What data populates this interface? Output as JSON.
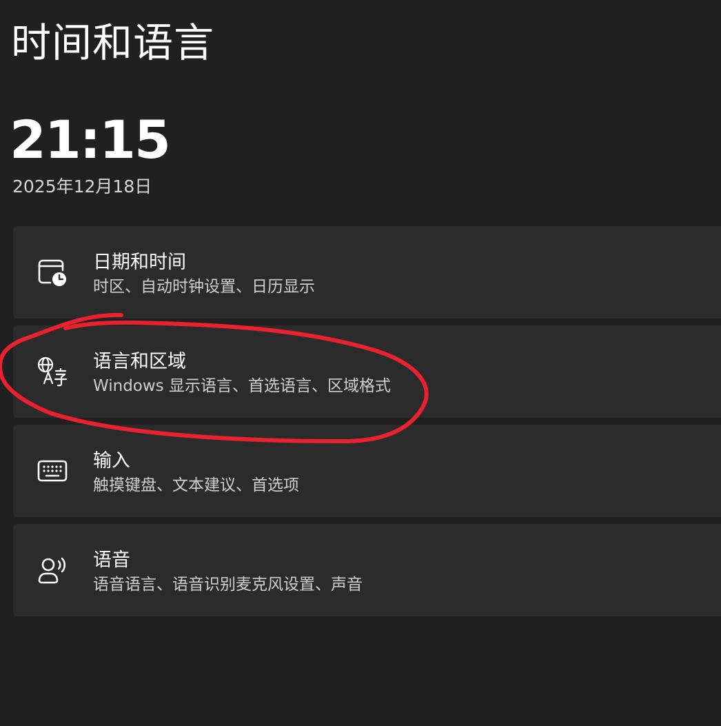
{
  "page": {
    "title": "时间和语言",
    "clock": "21:15",
    "date": "2025年12月18日"
  },
  "cards": [
    {
      "title": "日期和时间",
      "subtitle": "时区、自动时钟设置、日历显示",
      "icon": "calendar-clock-icon"
    },
    {
      "title": "语言和区域",
      "subtitle": "Windows 显示语言、首选语言、区域格式",
      "icon": "language-region-icon"
    },
    {
      "title": "输入",
      "subtitle": "触摸键盘、文本建议、首选项",
      "icon": "keyboard-icon"
    },
    {
      "title": "语音",
      "subtitle": "语音语言、语音识别麦克风设置、声音",
      "icon": "speech-icon"
    }
  ],
  "colors": {
    "background": "#202020",
    "card": "#2b2b2b",
    "annotation": "#e8222e"
  }
}
